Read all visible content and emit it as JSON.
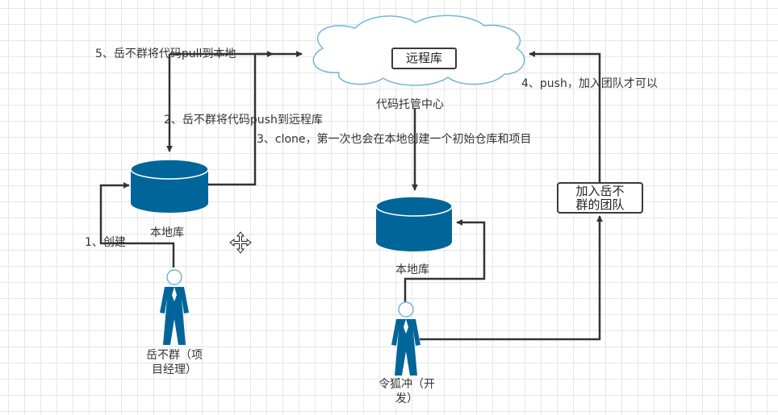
{
  "cloud": {
    "label": "远程库",
    "caption": "代码托管中心"
  },
  "team_box": {
    "line1": "加入岳不",
    "line2": "群的团队"
  },
  "repos": {
    "left_label": "本地库",
    "right_label": "本地库"
  },
  "people": {
    "manager_line1": "岳不群（项",
    "manager_line2": "目经理）",
    "developer_line1": "令狐冲（开",
    "developer_line2": "发）"
  },
  "steps": {
    "create": "1、创建",
    "push_remote": "2、岳不群将代码push到远程库",
    "clone": "3、clone，第一次也会在本地创建一个初始仓库和项目",
    "join_team": "4、push，加入团队才可以",
    "pull": "5、岳不群将代码pull到本地"
  },
  "colors": {
    "repo_fill": "#006699",
    "cloud_stroke": "#6fb7d6",
    "line": "#333333"
  },
  "icons": {
    "move_cursor": "move-cursor-icon"
  }
}
